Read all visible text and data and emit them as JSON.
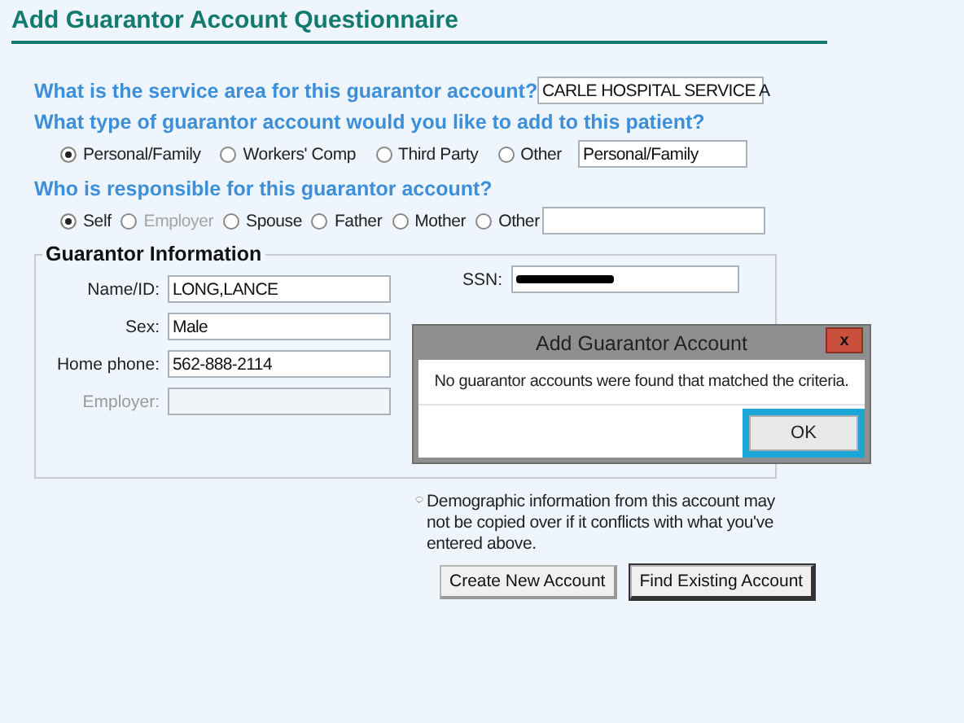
{
  "title": "Add Guarantor Account Questionnaire",
  "service_area": {
    "question": "What is the service area for this guarantor account?",
    "value": "CARLE HOSPITAL SERVICE A"
  },
  "account_type": {
    "question": "What type of guarantor account would you like to add to this patient?",
    "options": [
      {
        "label": "Personal/Family",
        "selected": true,
        "disabled": false
      },
      {
        "label": "Workers' Comp",
        "selected": false,
        "disabled": false
      },
      {
        "label": "Third Party",
        "selected": false,
        "disabled": false
      },
      {
        "label": "Other",
        "selected": false,
        "disabled": false
      }
    ],
    "value": "Personal/Family"
  },
  "responsible": {
    "question": "Who is responsible for this guarantor account?",
    "options": [
      {
        "label": "Self",
        "selected": true,
        "disabled": false
      },
      {
        "label": "Employer",
        "selected": false,
        "disabled": true
      },
      {
        "label": "Spouse",
        "selected": false,
        "disabled": false
      },
      {
        "label": "Father",
        "selected": false,
        "disabled": false
      },
      {
        "label": "Mother",
        "selected": false,
        "disabled": false
      },
      {
        "label": "Other",
        "selected": false,
        "disabled": false
      }
    ]
  },
  "guarantor_info": {
    "heading": "Guarantor Information",
    "fields": [
      {
        "label": "Name/ID:",
        "value": "LONG,LANCE",
        "disabled": false
      },
      {
        "label": "Sex:",
        "value": "Male",
        "disabled": false
      },
      {
        "label": "Home phone:",
        "value": "562-888-2114",
        "disabled": false
      },
      {
        "label": "Employer:",
        "disabled": true
      }
    ],
    "ssn": {
      "label": "SSN:",
      "redacted": true
    }
  },
  "note": "Demographic information from this account may not be copied over if it conflicts with what you've entered above.",
  "buttons": [
    {
      "label": "Create New Account",
      "default": false
    },
    {
      "label": "Find Existing Account",
      "default": true
    }
  ],
  "dialog": {
    "title": "Add Guarantor Account",
    "close": "x",
    "message": "No guarantor accounts were found that matched the criteria.",
    "button": "OK"
  }
}
